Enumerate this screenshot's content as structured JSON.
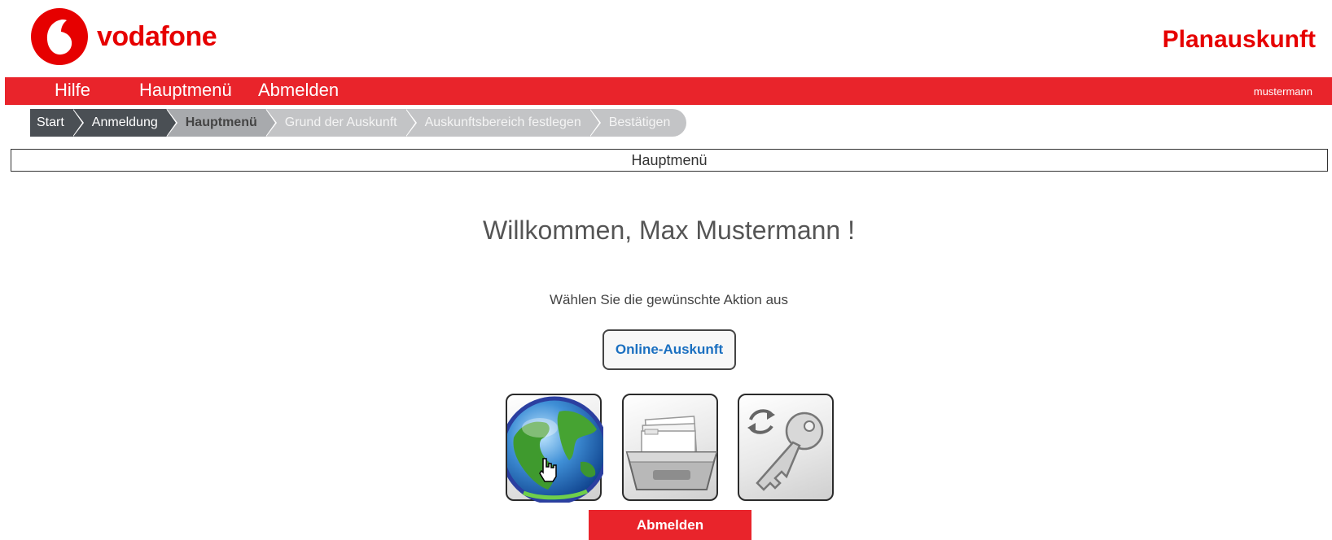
{
  "brand": {
    "logo_text": "vodafone",
    "logo_icon": "vodafone-speechmark-icon",
    "app_title": "Planauskunft",
    "accent": "#e60000"
  },
  "nav": {
    "items": [
      {
        "label": "Hilfe"
      },
      {
        "label": "Hauptmenü"
      },
      {
        "label": "Abmelden"
      }
    ],
    "user": "mustermann"
  },
  "breadcrumb": [
    {
      "label": "Start",
      "state": "done"
    },
    {
      "label": "Anmeldung",
      "state": "done"
    },
    {
      "label": "Hauptmenü",
      "state": "current"
    },
    {
      "label": "Grund der Auskunft",
      "state": "todo"
    },
    {
      "label": "Auskunftsbereich festlegen",
      "state": "todo"
    },
    {
      "label": "Bestätigen",
      "state": "todo"
    }
  ],
  "section_title": "Hauptmenü",
  "welcome": "Willkommen, Max Mustermann !",
  "instruction": "Wählen Sie die gewünschte Aktion aus",
  "actions": {
    "online_label": "Online-Auskunft",
    "tiles": [
      {
        "icon": "globe-icon"
      },
      {
        "icon": "card-file-box-icon"
      },
      {
        "icon": "key-refresh-icon"
      }
    ]
  },
  "logout_button": "Abmelden"
}
